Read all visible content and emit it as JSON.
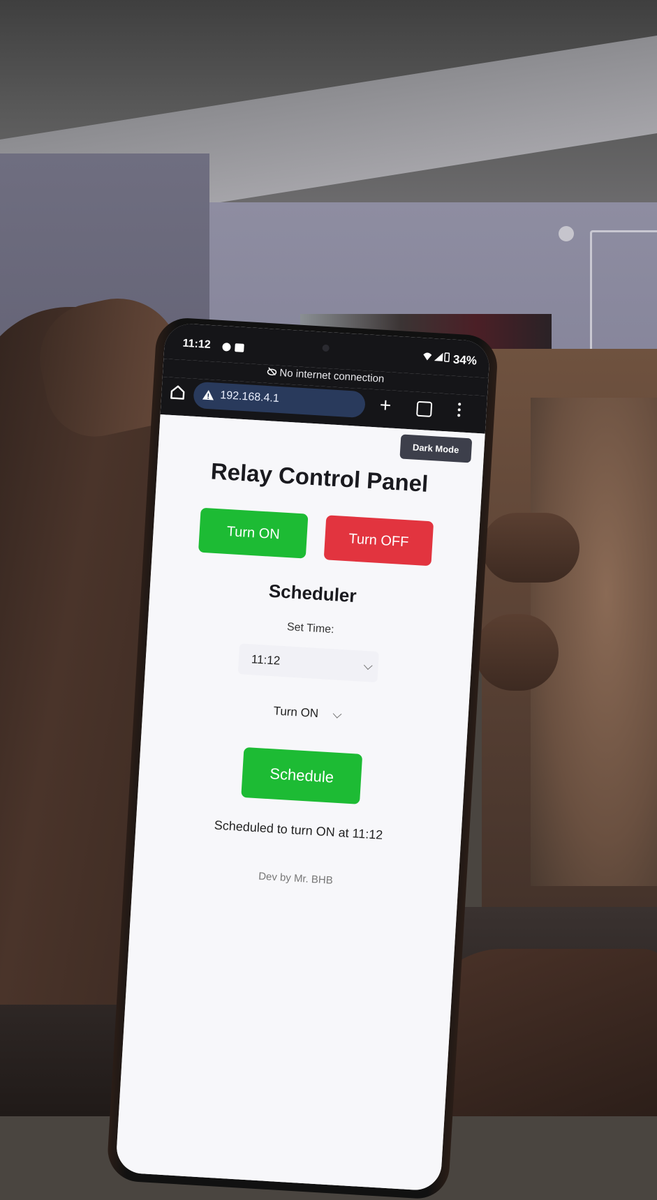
{
  "status_bar": {
    "time": "11:12",
    "battery": "34%"
  },
  "notice": "No internet connection",
  "browser": {
    "url": "192.168.4.1"
  },
  "page": {
    "dark_mode_label": "Dark Mode",
    "title": "Relay Control Panel",
    "turn_on_label": "Turn ON",
    "turn_off_label": "Turn OFF",
    "scheduler_title": "Scheduler",
    "set_time_label": "Set Time:",
    "time_value": "11:12",
    "action_value": "Turn ON",
    "schedule_label": "Schedule",
    "status_message": "Scheduled to turn ON at 11:12",
    "footer": "Dev by Mr. BHB"
  },
  "colors": {
    "on_green": "#1dbb34",
    "off_red": "#e2343f",
    "dark_mode_bg": "#3d3f4b",
    "url_pill": "#293a5c"
  }
}
